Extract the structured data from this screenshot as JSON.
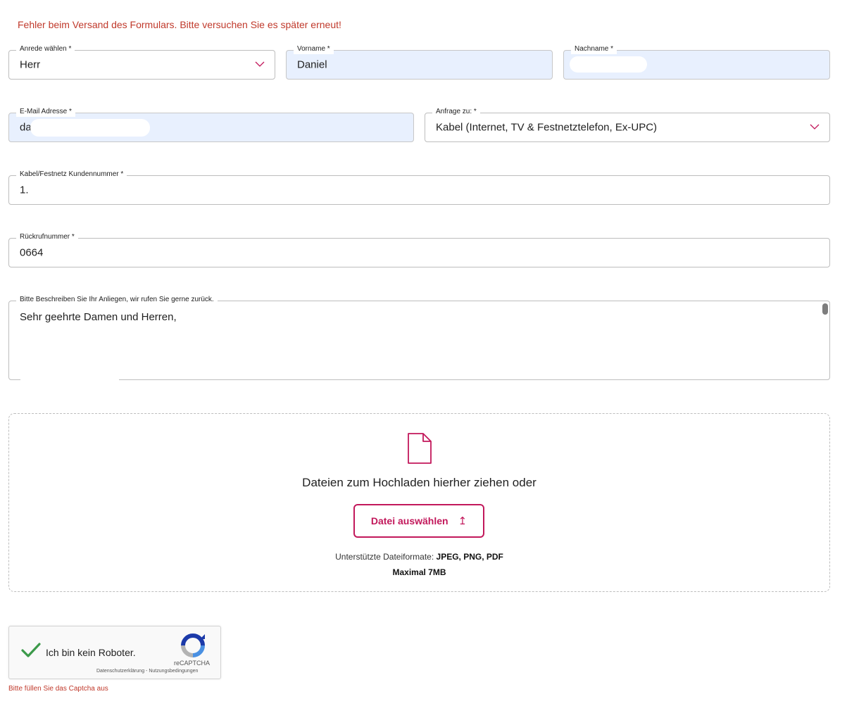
{
  "error_message": "Fehler beim Versand des Formulars. Bitte versuchen Sie es später erneut!",
  "fields": {
    "anrede": {
      "label": "Anrede wählen *",
      "value": "Herr"
    },
    "vorname": {
      "label": "Vorname *",
      "value": "Daniel"
    },
    "nachname": {
      "label": "Nachname *",
      "value": ""
    },
    "email": {
      "label": "E-Mail Adresse *",
      "value": "da"
    },
    "anfrage": {
      "label": "Anfrage zu: *",
      "value": "Kabel (Internet, TV & Festnetztelefon, Ex-UPC)"
    },
    "kundennummer": {
      "label": "Kabel/Festnetz Kundennummer *",
      "value": "1."
    },
    "rueckrufnummer": {
      "label": "Rückrufnummer *",
      "value": "0664"
    },
    "anliegen": {
      "label": "Bitte Beschreiben Sie Ihr Anliegen, wir rufen Sie gerne zurück.",
      "value": "Sehr geehrte Damen und Herren,"
    }
  },
  "upload": {
    "drop_text": "Dateien zum Hochladen hierher ziehen oder",
    "button_label": "Datei auswählen",
    "button_icon": "↥",
    "formats_label": "Unterstützte Dateiformate:",
    "formats_value": "JPEG, PNG, PDF",
    "max_size": "Maximal 7MB"
  },
  "recaptcha": {
    "label": "Ich bin kein Roboter.",
    "brand": "reCAPTCHA",
    "links": "Datenschutzerklärung - Nutzungsbedingungen",
    "checked": true
  },
  "captcha_error": "Bitte füllen Sie das Captcha aus",
  "colors": {
    "accent": "#c2185b",
    "error": "#c0392b",
    "autofill": "#e8f0fe",
    "check": "#3c9a4a"
  }
}
